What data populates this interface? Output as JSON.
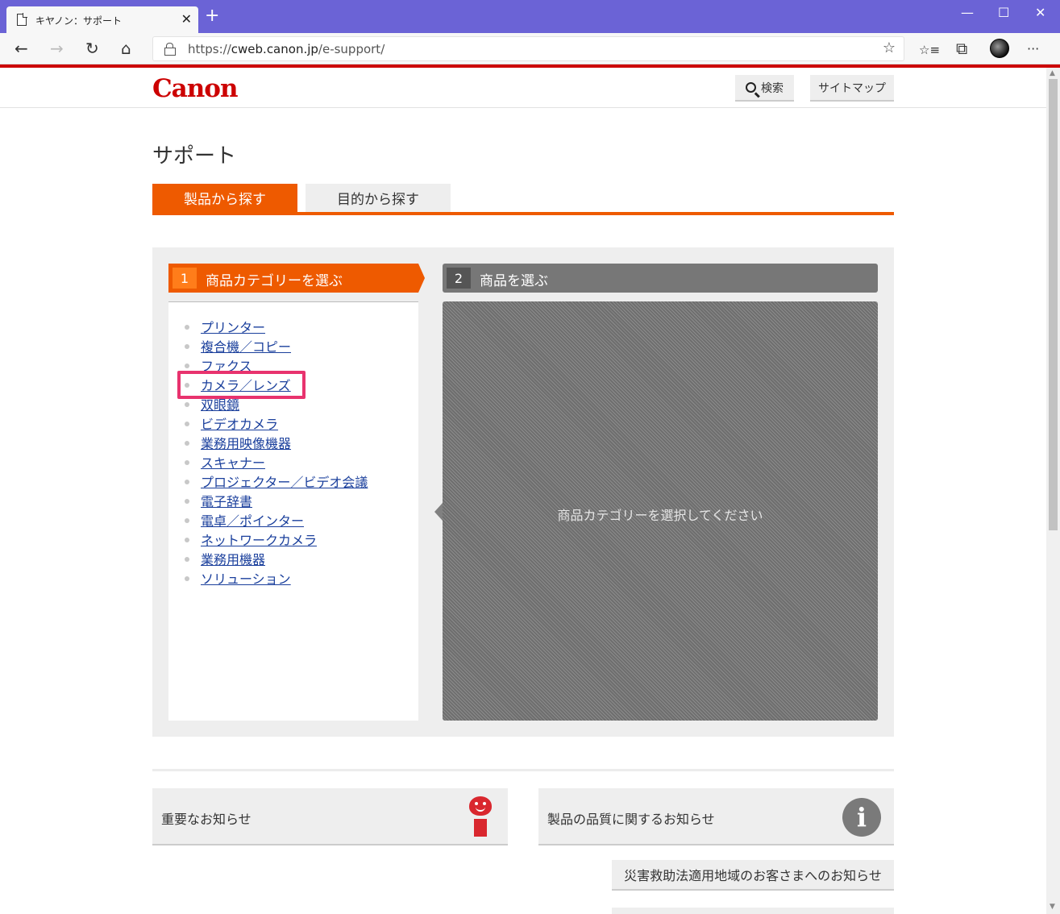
{
  "browser": {
    "tab_title": "キヤノン：サポート",
    "tab_close": "✕",
    "new_tab": "+",
    "url_prefix": "https://",
    "url_host": "cweb.canon.jp",
    "url_path": "/e-support/",
    "window_controls": {
      "minimize": "—",
      "maximize": "☐",
      "close": "✕"
    },
    "nav": {
      "back": "←",
      "forward": "→",
      "refresh": "↻",
      "home": "⌂",
      "favorite_star": "☆",
      "favorites": "☆≡",
      "collections": "⧉",
      "more": "···"
    }
  },
  "header": {
    "logo": "Canon",
    "search_label": "検索",
    "sitemap_label": "サイトマップ"
  },
  "page": {
    "title": "サポート",
    "tabs": [
      {
        "label": "製品から探す",
        "active": true
      },
      {
        "label": "目的から探す",
        "active": false
      }
    ]
  },
  "selector": {
    "step1": {
      "num": "1",
      "label": "商品カテゴリーを選ぶ"
    },
    "step2": {
      "num": "2",
      "label": "商品を選ぶ"
    },
    "categories": [
      "プリンター",
      "複合機／コピー",
      "ファクス",
      "カメラ／レンズ",
      "双眼鏡",
      "ビデオカメラ",
      "業務用映像機器",
      "スキャナー",
      "プロジェクター／ビデオ会議",
      "電子辞書",
      "電卓／ポインター",
      "ネットワークカメラ",
      "業務用機器",
      "ソリューション"
    ],
    "highlighted_category": "カメラ／レンズ",
    "product_placeholder": "商品カテゴリーを選択してください"
  },
  "notices": {
    "important": "重要なお知らせ",
    "quality": "製品の品質に関するお知らせ",
    "disaster": "災害救助法適用地域のお客さまへのお知らせ"
  },
  "colors": {
    "accent": "#ee5a00",
    "brand": "#cc0000",
    "link": "#1a3f9c",
    "highlight": "#e8336e",
    "titlebar": "#6b63d6"
  }
}
